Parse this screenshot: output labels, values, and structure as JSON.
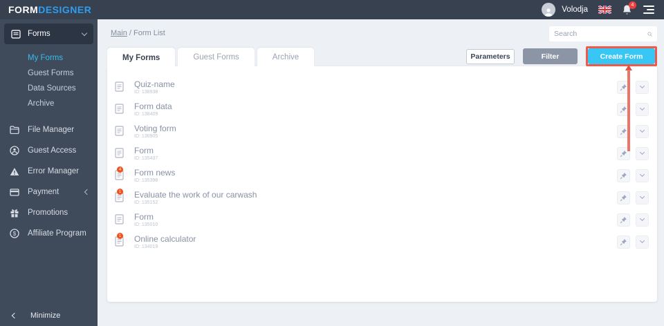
{
  "topbar": {
    "logo_part1": "FORM",
    "logo_part2": "DESIGNER",
    "user_name": "Volodja",
    "notification_count": "4"
  },
  "sidebar": {
    "forms_group_label": "Forms",
    "forms_children": [
      {
        "label": "My Forms"
      },
      {
        "label": "Guest Forms"
      },
      {
        "label": "Data Sources"
      },
      {
        "label": "Archive"
      }
    ],
    "items": [
      {
        "label": "File Manager"
      },
      {
        "label": "Guest Access"
      },
      {
        "label": "Error Manager"
      },
      {
        "label": "Payment"
      },
      {
        "label": "Promotions"
      },
      {
        "label": "Affiliate Program"
      }
    ],
    "minimize_label": "Minimize"
  },
  "breadcrumb": {
    "root": "Main",
    "separator": " / ",
    "current": "Form List"
  },
  "search": {
    "placeholder": "Search"
  },
  "tabs": [
    {
      "label": "My Forms"
    },
    {
      "label": "Guest Forms"
    },
    {
      "label": "Archive"
    }
  ],
  "toolbar": {
    "parameters_label": "Parameters",
    "filter_label": "Filter",
    "create_form_label": "Create Form"
  },
  "forms": {
    "rows": [
      {
        "name": "Quiz-name",
        "id": "ID: 138938"
      },
      {
        "name": "Form data",
        "id": "ID: 138409"
      },
      {
        "name": "Voting form",
        "id": "ID: 136905"
      },
      {
        "name": "Form",
        "id": "ID: 135437"
      },
      {
        "name": "Form news",
        "id": "ID: 135398",
        "badge": "4"
      },
      {
        "name": "Evaluate the work of our carwash",
        "id": "ID: 135152",
        "badge": "1"
      },
      {
        "name": "Form",
        "id": "ID: 135010"
      },
      {
        "name": "Online calculator",
        "id": "ID: 134019",
        "badge": "1"
      }
    ]
  },
  "colors": {
    "topbar_bg": "#38414f",
    "sidebar_bg": "#3f4a5a",
    "accent_blue": "#35bdf2",
    "create_button": "#38c6f4",
    "annotation_red": "#ee5a4a",
    "badge_orange": "#f4511e",
    "notification_red": "#f03e3e"
  }
}
